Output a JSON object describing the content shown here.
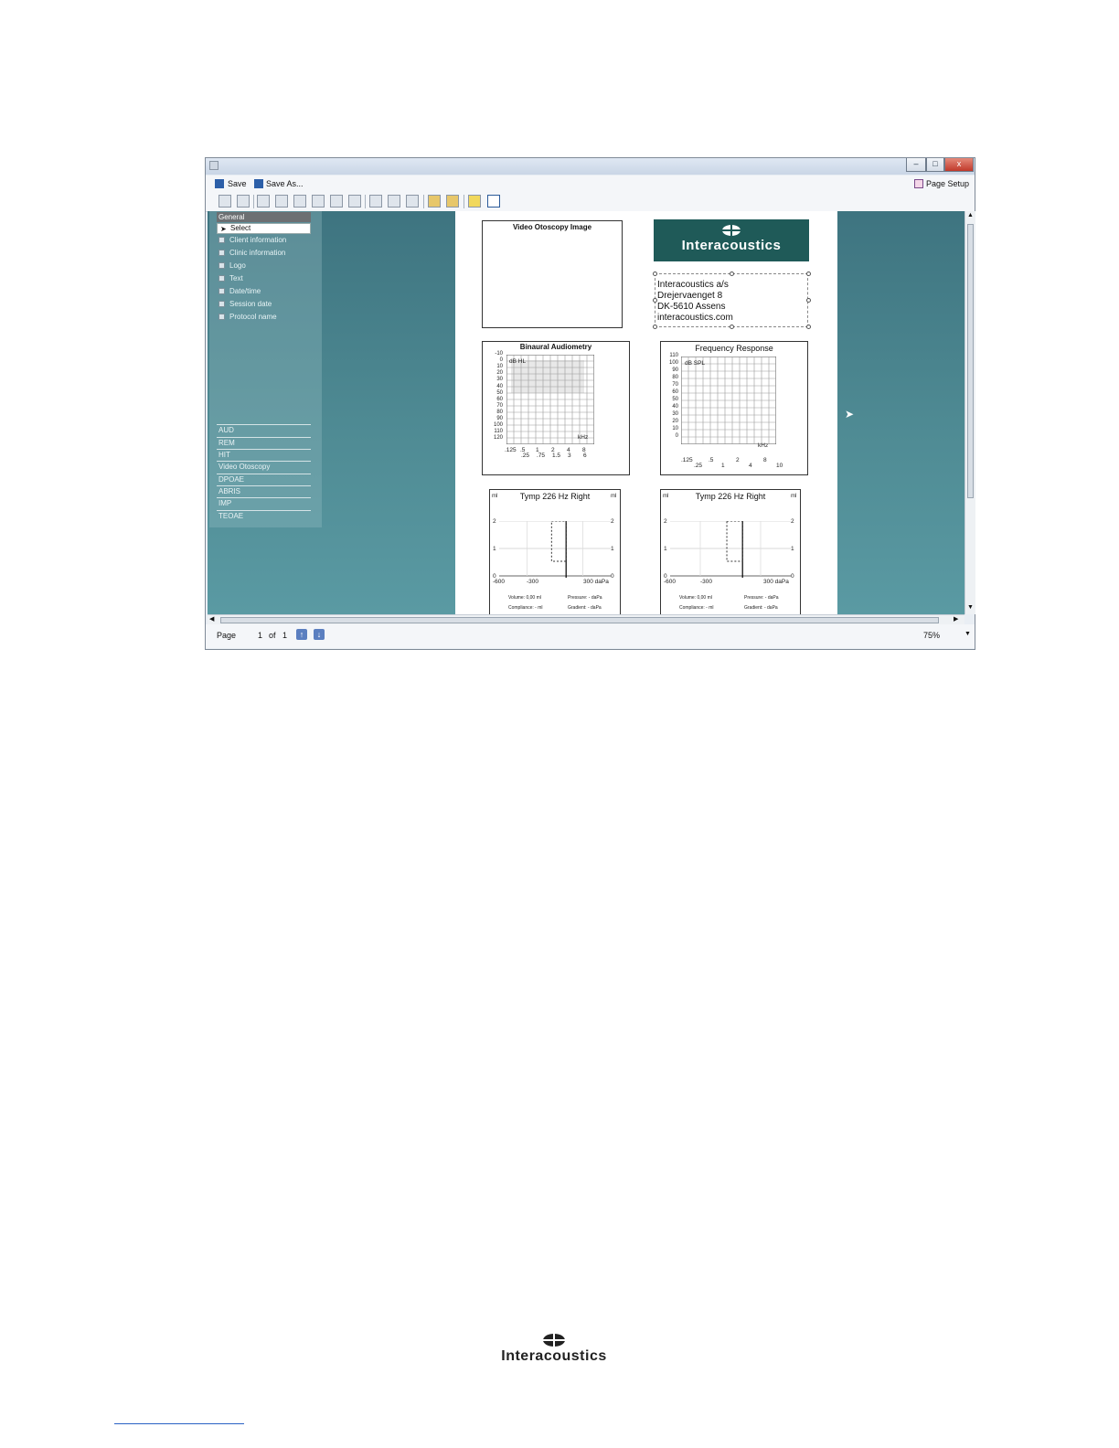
{
  "window": {
    "controls": [
      "–",
      "□",
      "x"
    ],
    "menu": {
      "save": "Save",
      "save_as": "Save As...",
      "page_setup": "Page Setup"
    }
  },
  "panel": {
    "group_title": "General",
    "selected_item": "Select",
    "items": [
      "Client information",
      "Clinic information",
      "Logo",
      "Text",
      "Date/time",
      "Session date",
      "Protocol name"
    ],
    "categories": [
      "AUD",
      "REM",
      "HIT",
      "Video Otoscopy",
      "DPOAE",
      "ABRIS",
      "IMP",
      "TEOAE"
    ]
  },
  "paper": {
    "video_title": "Video Otoscopy Image",
    "logo_text": "Interacoustics",
    "address": [
      "Interacoustics a/s",
      "Drejervaenget 8",
      "DK-5610 Assens",
      "interacoustics.com"
    ],
    "audiometry": {
      "title": "Binaural Audiometry",
      "unit": "dB HL",
      "y_ticks": [
        "-10",
        "0",
        "10",
        "20",
        "30",
        "40",
        "50",
        "60",
        "70",
        "80",
        "90",
        "100",
        "110",
        "120"
      ],
      "x_ticks_top": [
        ".125",
        ".5",
        "1",
        "2",
        "4",
        "8"
      ],
      "x_ticks_bottom": [
        ".25",
        ".75",
        "1.5",
        "3",
        "6"
      ],
      "x_unit": "kHz"
    },
    "freq_response": {
      "title": "Frequency Response",
      "unit": "dB SPL",
      "y_ticks": [
        "110",
        "100",
        "90",
        "80",
        "70",
        "60",
        "50",
        "40",
        "30",
        "20",
        "10",
        "0"
      ],
      "x_ticks_top": [
        ".125",
        ".5",
        "2",
        "8"
      ],
      "x_ticks_bottom": [
        ".25",
        "1",
        "4",
        "10"
      ],
      "x_unit": "kHz"
    },
    "tymp": [
      {
        "title": "Tymp 226 Hz Right",
        "unit_left": "ml",
        "unit_right": "ml",
        "y_ticks": [
          "2",
          "1",
          "0"
        ],
        "x_ticks": [
          "-600",
          "-300",
          "300 daPa"
        ],
        "volume": "Volume: 0,00 ml",
        "pressure": "Pressure: - daPa",
        "compliance": "Compliance: - ml",
        "gradient": "Gradient: - daPa"
      },
      {
        "title": "Tymp 226 Hz Right",
        "unit_left": "ml",
        "unit_right": "ml",
        "y_ticks": [
          "2",
          "1",
          "0"
        ],
        "x_ticks": [
          "-600",
          "-300",
          "300 daPa"
        ],
        "volume": "Volume: 0,00 ml",
        "pressure": "Pressure: - daPa",
        "compliance": "Compliance: - ml",
        "gradient": "Gradient: - daPa"
      }
    ]
  },
  "statusbar": {
    "page_label": "Page",
    "page_current": "1",
    "of_label": "of",
    "page_total": "1",
    "zoom": "75%"
  },
  "footer": {
    "logo_text": "Interacoustics"
  }
}
